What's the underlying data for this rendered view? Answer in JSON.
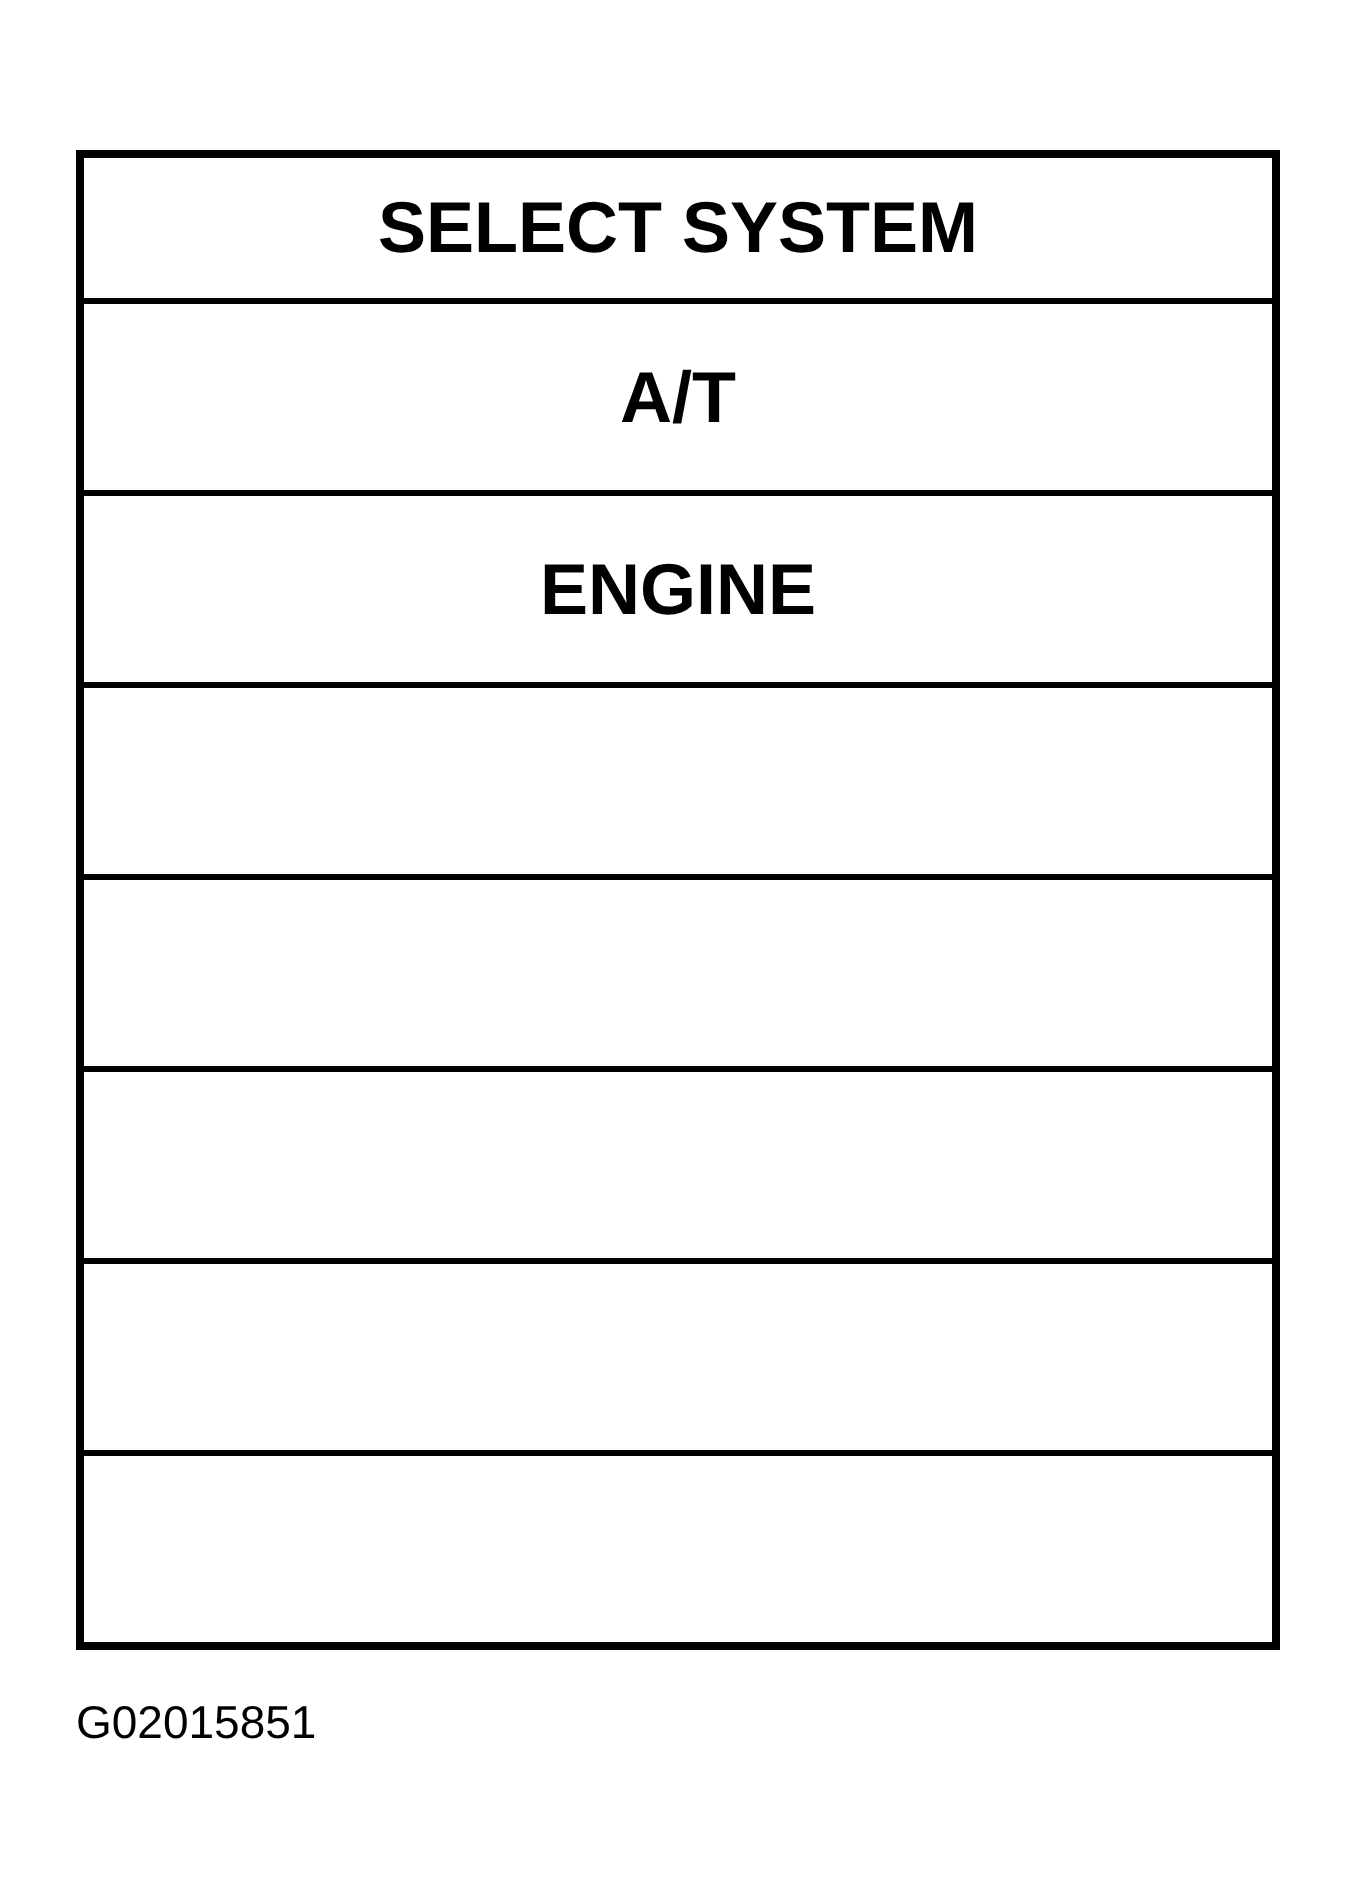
{
  "menu": {
    "title": "SELECT SYSTEM",
    "rows": [
      {
        "kind": "item",
        "label": "A/T"
      },
      {
        "kind": "item",
        "label": "ENGINE"
      },
      {
        "kind": "blank"
      },
      {
        "kind": "blank"
      },
      {
        "kind": "blank"
      },
      {
        "kind": "blank"
      },
      {
        "kind": "blank"
      }
    ]
  },
  "figure_code": "G02015851"
}
